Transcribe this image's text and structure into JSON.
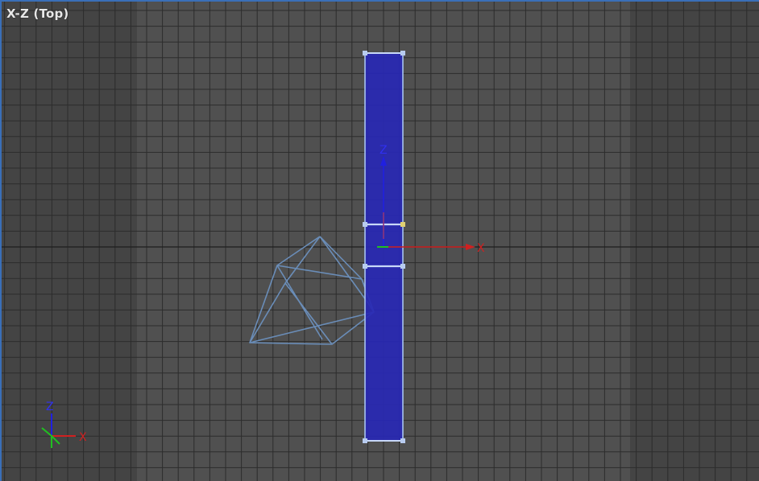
{
  "viewport": {
    "label": "X-Z (Top)"
  },
  "gizmo": {
    "z_label": "Z",
    "x_label": "X"
  },
  "corner_axes": {
    "z_label": "Z",
    "x_label": "X"
  },
  "colors": {
    "selection_fill": "#2828b4",
    "selection_edge": "#a8c4f0",
    "camera_wire": "#6a8db8",
    "axis_x": "#d02020",
    "axis_z": "#2020e0",
    "axis_y": "#20c020",
    "viewport_border": "#3a6fb8"
  },
  "icons": {
    "gizmo": "move-gizmo-icon",
    "corner_axes": "axis-orientation-icon",
    "camera": "camera-wireframe-icon"
  }
}
